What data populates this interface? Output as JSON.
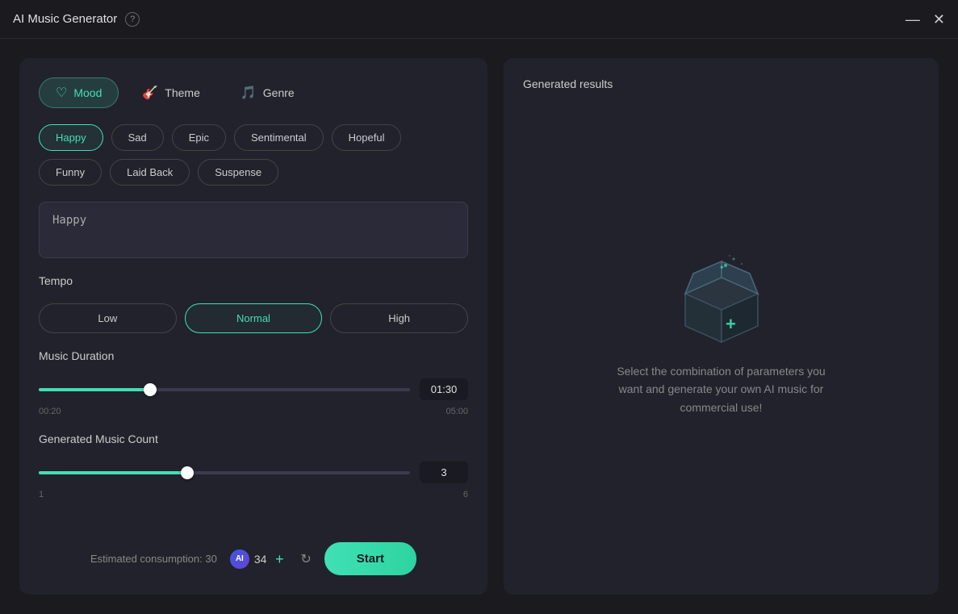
{
  "titleBar": {
    "title": "AI Music Generator",
    "helpLabel": "?",
    "minimizeIcon": "—",
    "closeIcon": "✕"
  },
  "tabs": [
    {
      "id": "mood",
      "label": "Mood",
      "icon": "♡",
      "active": true
    },
    {
      "id": "theme",
      "label": "Theme",
      "icon": "🎸",
      "active": false
    },
    {
      "id": "genre",
      "label": "Genre",
      "icon": "🎵",
      "active": false
    }
  ],
  "moodButtons": [
    {
      "label": "Happy",
      "selected": true
    },
    {
      "label": "Sad",
      "selected": false
    },
    {
      "label": "Epic",
      "selected": false
    },
    {
      "label": "Sentimental",
      "selected": false
    },
    {
      "label": "Hopeful",
      "selected": false
    },
    {
      "label": "Funny",
      "selected": false
    },
    {
      "label": "Laid Back",
      "selected": false
    },
    {
      "label": "Suspense",
      "selected": false
    }
  ],
  "moodInputValue": "Happy",
  "tempo": {
    "label": "Tempo",
    "options": [
      {
        "label": "Low",
        "selected": false
      },
      {
        "label": "Normal",
        "selected": true
      },
      {
        "label": "High",
        "selected": false
      }
    ]
  },
  "musicDuration": {
    "label": "Music Duration",
    "min": "00:20",
    "max": "05:00",
    "value": "01:30",
    "fillPercent": 30
  },
  "musicCount": {
    "label": "Generated Music Count",
    "min": "1",
    "max": "6",
    "value": "3",
    "fillPercent": 40
  },
  "bottom": {
    "estimatedConsumption": "Estimated consumption: 30",
    "aiLabel": "AI",
    "credits": "34",
    "addLabel": "+",
    "refreshLabel": "↻",
    "startLabel": "Start"
  },
  "rightPanel": {
    "title": "Generated results",
    "emptyDesc": "Select the combination of parameters you want and generate your own AI music for commercial use!"
  }
}
